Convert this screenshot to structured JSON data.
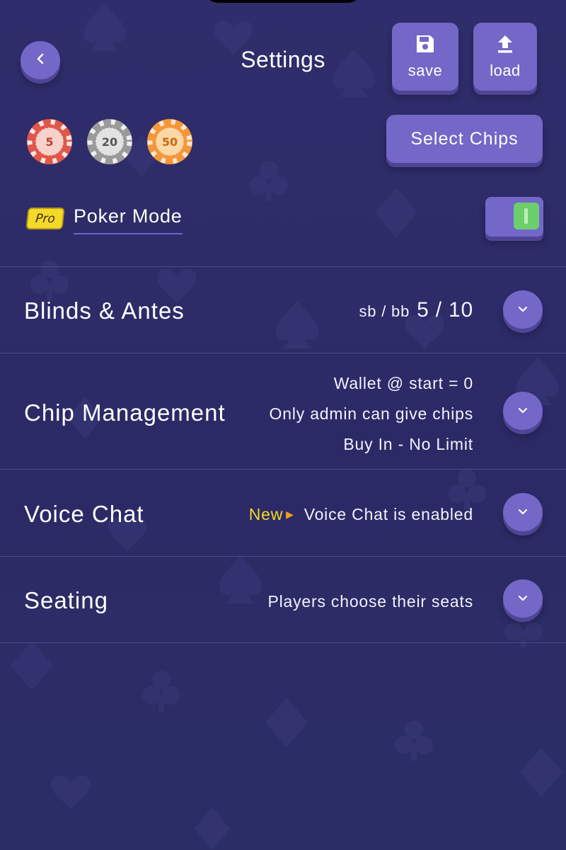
{
  "header": {
    "title": "Settings",
    "save_label": "save",
    "load_label": "load"
  },
  "chips": {
    "items": [
      {
        "value": "5",
        "color": "#e0574a"
      },
      {
        "value": "20",
        "color": "#9a9a9a"
      },
      {
        "value": "50",
        "color": "#f3973a"
      }
    ],
    "select_label": "Select Chips"
  },
  "poker_mode": {
    "badge": "Pro",
    "label": "Poker Mode",
    "enabled": true
  },
  "sections": {
    "blinds": {
      "title": "Blinds & Antes",
      "sb_bb_label": "sb / bb",
      "sb_bb_value": "5 / 10"
    },
    "chip_management": {
      "title": "Chip Management",
      "line1": "Wallet @ start = 0",
      "line2": "Only admin can give chips",
      "line3": "Buy In - No Limit"
    },
    "voice_chat": {
      "title": "Voice Chat",
      "new_tag": "New",
      "status": "Voice Chat is enabled"
    },
    "seating": {
      "title": "Seating",
      "status": "Players choose their seats"
    }
  },
  "colors": {
    "background": "#2e2c69",
    "button": "#7367c8",
    "button_shadow": "#4f4596",
    "toggle_on": "#6ccf6c",
    "pro_badge": "#f4d92a",
    "new_tag": "#f4d92a"
  },
  "icons": {
    "back": "chevron-left-icon",
    "save": "floppy-disk-icon",
    "load": "upload-icon",
    "expand": "chevron-down-icon"
  }
}
